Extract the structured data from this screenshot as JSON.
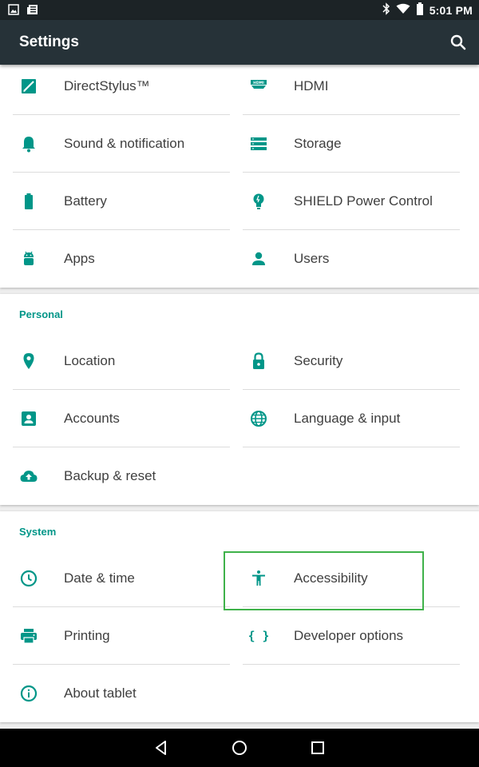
{
  "status_bar": {
    "time": "5:01 PM",
    "left_icons": [
      "image-icon",
      "news-icon"
    ],
    "right_icons": [
      "bluetooth-icon",
      "wifi-icon",
      "battery-icon"
    ]
  },
  "app_bar": {
    "title": "Settings",
    "search_icon": "search-icon"
  },
  "sections": {
    "device": {
      "items": [
        {
          "label": "DirectStylus™",
          "icon": "stylus-icon"
        },
        {
          "label": "HDMI",
          "icon": "hdmi-icon"
        },
        {
          "label": "Sound & notification",
          "icon": "bell-icon"
        },
        {
          "label": "Storage",
          "icon": "storage-icon"
        },
        {
          "label": "Battery",
          "icon": "battery-icon"
        },
        {
          "label": "SHIELD Power Control",
          "icon": "bulb-icon"
        },
        {
          "label": "Apps",
          "icon": "android-icon"
        },
        {
          "label": "Users",
          "icon": "person-icon"
        }
      ]
    },
    "personal": {
      "header": "Personal",
      "items": [
        {
          "label": "Location",
          "icon": "location-pin-icon"
        },
        {
          "label": "Security",
          "icon": "lock-icon"
        },
        {
          "label": "Accounts",
          "icon": "account-box-icon"
        },
        {
          "label": "Language & input",
          "icon": "globe-icon"
        },
        {
          "label": "Backup & reset",
          "icon": "cloud-upload-icon"
        }
      ]
    },
    "system": {
      "header": "System",
      "items": [
        {
          "label": "Date & time",
          "icon": "clock-icon"
        },
        {
          "label": "Accessibility",
          "icon": "accessibility-icon"
        },
        {
          "label": "Printing",
          "icon": "printer-icon"
        },
        {
          "label": "Developer options",
          "icon": "braces-icon"
        },
        {
          "label": "About tablet",
          "icon": "info-icon"
        }
      ]
    }
  },
  "highlighted_item": "Accessibility",
  "nav_bar": {
    "icons": [
      "back-icon",
      "home-icon",
      "recents-icon"
    ]
  },
  "colors": {
    "accent": "#009688",
    "app_bar": "#263238",
    "status_bar": "#1c2326",
    "highlight": "#3fb24a"
  }
}
